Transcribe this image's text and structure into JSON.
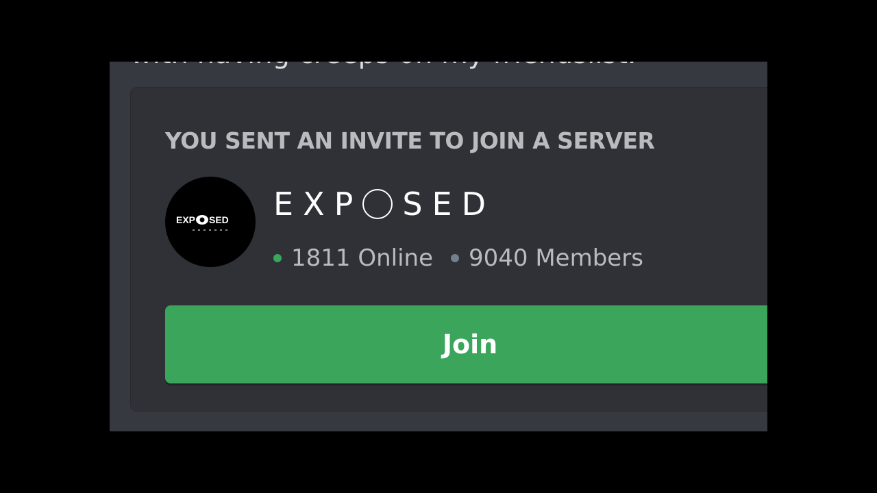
{
  "message": {
    "partial_text": "with having creeps on my friendslist."
  },
  "invite": {
    "header": "YOU SENT AN INVITE TO JOIN A SERVER",
    "server": {
      "name_prefix": "EXP",
      "name_suffix": "SED",
      "icon_text_prefix": "EXP",
      "icon_text_suffix": "SED"
    },
    "online_label": "1811 Online",
    "members_label": "9040 Members",
    "join_label": "Join"
  },
  "colors": {
    "background": "#000000",
    "chat_bg": "#36393f",
    "card_bg": "#2f3136",
    "join_button": "#3ba55c",
    "online_dot": "#3ba55c",
    "members_dot": "#747f8d",
    "header_text": "#b9bbbe"
  },
  "icons": {
    "online": "online-status-dot-icon",
    "members": "members-dot-icon",
    "server_logo": "exposed-server-logo-icon"
  }
}
